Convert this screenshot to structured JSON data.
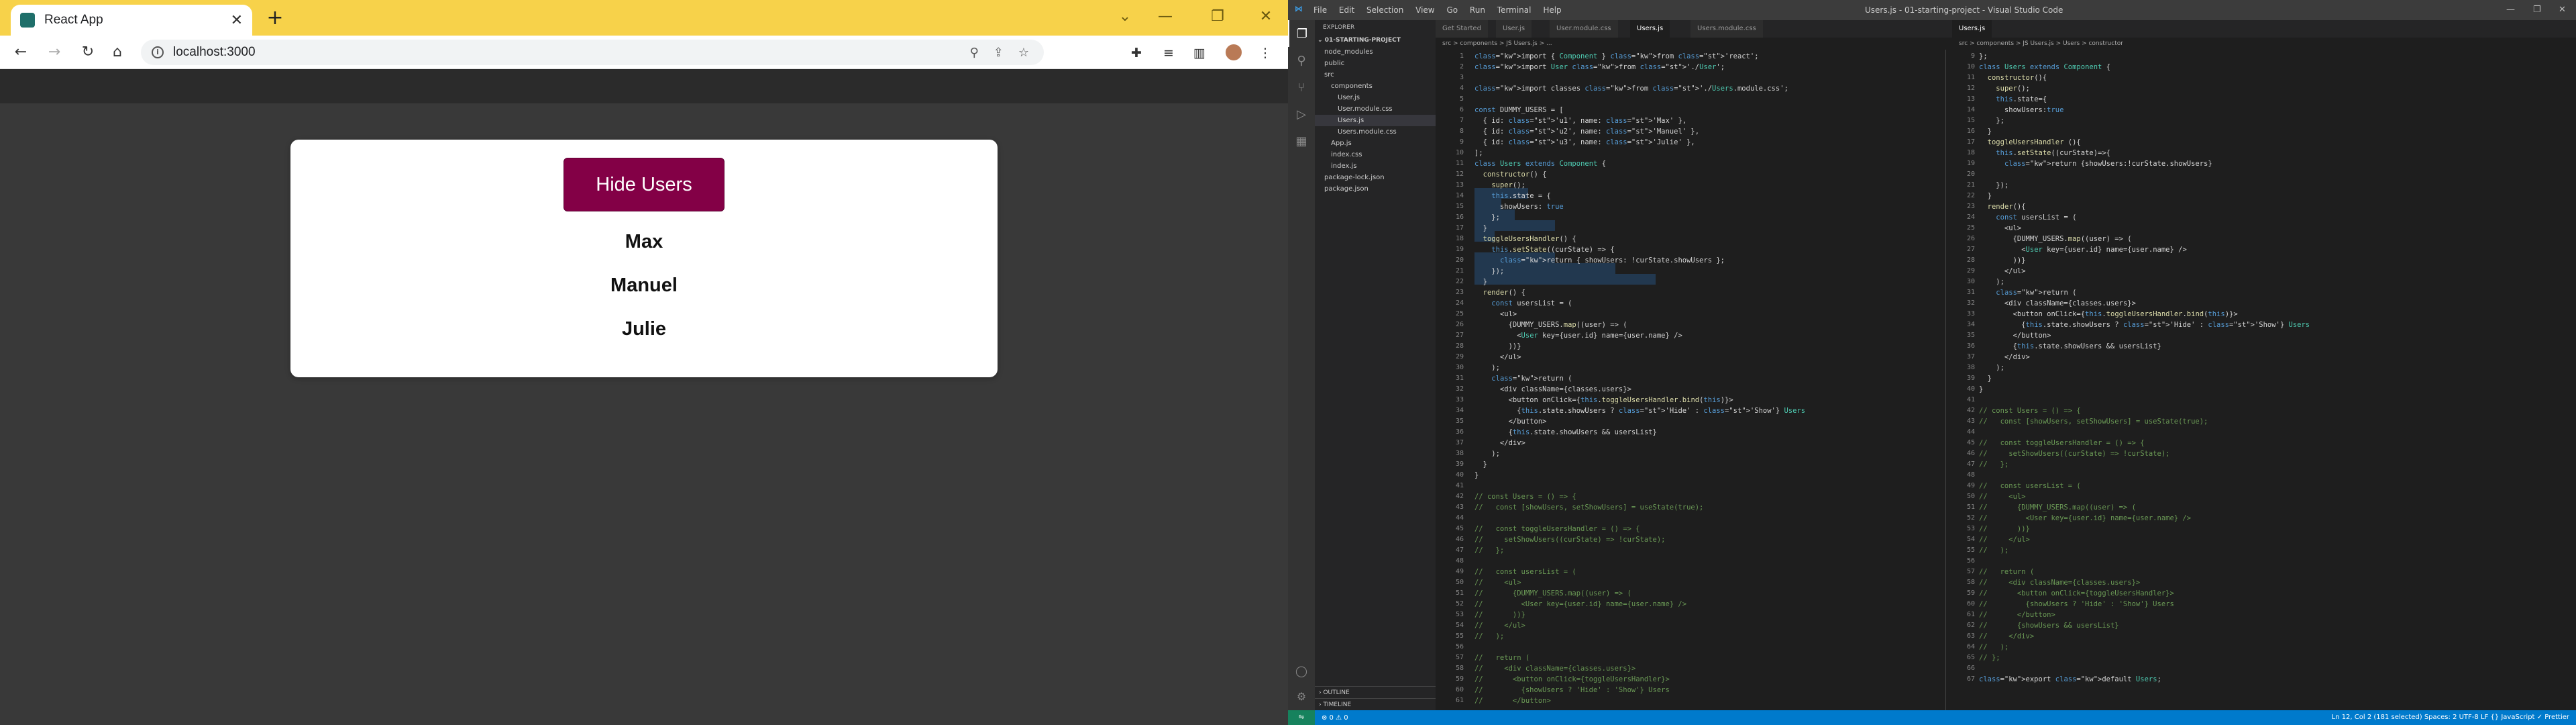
{
  "browser": {
    "tab_title": "React App",
    "tab_close": "✕",
    "new_tab": "+",
    "url": "localhost:3000",
    "win_min": "⌄",
    "win_restore": "—",
    "win_max": "❐",
    "win_close": "✕"
  },
  "app": {
    "button_label": "Hide Users",
    "users": [
      "Max",
      "Manuel",
      "Julie"
    ]
  },
  "vscode": {
    "menu": [
      "File",
      "Edit",
      "Selection",
      "View",
      "Go",
      "Run",
      "Terminal",
      "Help"
    ],
    "window_title": "Users.js - 01-starting-project - Visual Studio Code",
    "explorer_title": "EXPLORER",
    "project": "01-STARTING-PROJECT",
    "tree": [
      {
        "label": "node_modules",
        "indent": 1
      },
      {
        "label": "public",
        "indent": 1
      },
      {
        "label": "src",
        "indent": 1
      },
      {
        "label": "components",
        "indent": 2
      },
      {
        "label": "User.js",
        "indent": 3
      },
      {
        "label": "User.module.css",
        "indent": 3
      },
      {
        "label": "Users.js",
        "indent": 3,
        "selected": true
      },
      {
        "label": "Users.module.css",
        "indent": 3
      },
      {
        "label": "App.js",
        "indent": 2
      },
      {
        "label": "index.css",
        "indent": 2
      },
      {
        "label": "index.js",
        "indent": 2
      },
      {
        "label": "package-lock.json",
        "indent": 1
      },
      {
        "label": "package.json",
        "indent": 1
      }
    ],
    "outline": "OUTLINE",
    "timeline": "TIMELINE",
    "tabs_left": [
      "Get Started",
      "User.js",
      "User.module.css",
      "Users.js",
      "Users.module.css"
    ],
    "tabs_right": [
      "Users.js"
    ],
    "crumb_left": "src > components > JS Users.js > ...",
    "crumb_right": "src > components > JS Users.js > Users > constructor",
    "status_left": "⊗ 0 ⚠ 0",
    "status_right": "Ln 12, Col 2 (181 selected)   Spaces: 2   UTF-8   LF   {} JavaScript   ✓ Prettier"
  }
}
